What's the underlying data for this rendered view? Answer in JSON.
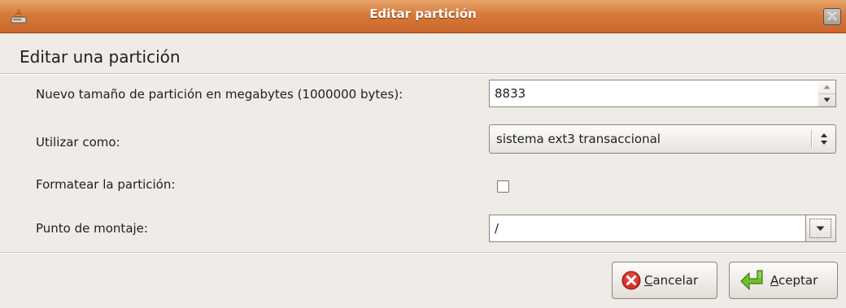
{
  "window": {
    "title": "Editar partición",
    "icons": {
      "app": "installer-icon",
      "close": "close-icon"
    }
  },
  "dialog": {
    "heading": "Editar una partición"
  },
  "form": {
    "size": {
      "label": "Nuevo tamaño de partición en megabytes (1000000 bytes):",
      "value": "8833",
      "spin_icons": [
        "spin-up-icon",
        "spin-down-icon"
      ]
    },
    "use_as": {
      "label": "Utilizar como:",
      "selected": "sistema ext3 transaccional",
      "icon": "combo-arrows-icon"
    },
    "format": {
      "label": "Formatear la partición:",
      "checked": false
    },
    "mount_point": {
      "label": "Punto de montaje:",
      "value": "/",
      "icon": "dropdown-arrow-icon"
    }
  },
  "buttons": {
    "cancel": {
      "mnemonic": "C",
      "rest": "ancelar",
      "icon": "cancel-icon",
      "icon_color": "#d3302a"
    },
    "accept": {
      "mnemonic": "A",
      "rest": "ceptar",
      "icon": "return-arrow-icon",
      "icon_color": "#5aaa1f"
    }
  }
}
